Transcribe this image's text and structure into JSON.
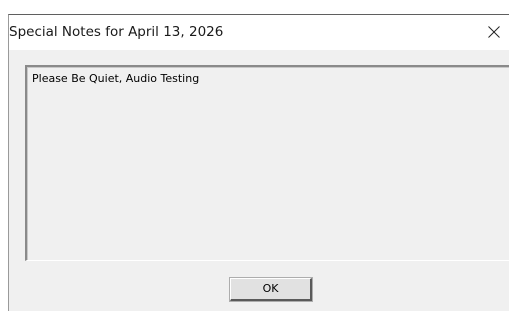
{
  "window": {
    "title": "Special Notes for April 13, 2026"
  },
  "notes": {
    "text": "Please Be Quiet, Audio Testing"
  },
  "buttons": {
    "ok_label": "OK"
  },
  "icons": {
    "close": "close-icon"
  }
}
